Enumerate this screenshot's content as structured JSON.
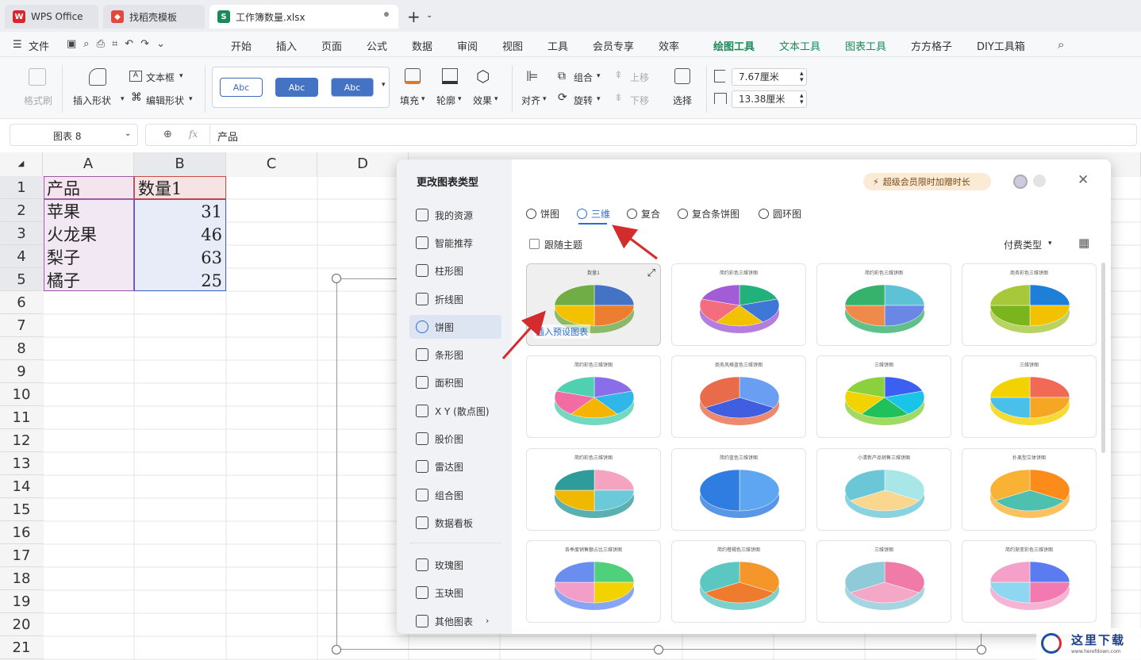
{
  "tabs": [
    {
      "label": "WPS Office",
      "icon": "wps-logo-icon"
    },
    {
      "label": "找稻壳模板",
      "icon": "docer-icon"
    },
    {
      "label": "工作簿数量.xlsx",
      "icon": "spreadsheet-icon"
    }
  ],
  "menu": {
    "file": "文件",
    "items": [
      "开始",
      "插入",
      "页面",
      "公式",
      "数据",
      "审阅",
      "视图",
      "工具",
      "会员专享",
      "效率",
      "绘图工具",
      "文本工具",
      "图表工具",
      "方方格子",
      "DIY工具箱"
    ]
  },
  "ribbon": {
    "format_painter": "格式刷",
    "insert_shape": "插入形状",
    "text_box": "文本框",
    "edit_shape": "编辑形状",
    "styles": [
      "Abc",
      "Abc",
      "Abc"
    ],
    "fill": "填充",
    "outline": "轮廓",
    "effect": "效果",
    "align": "对齐",
    "group": "组合",
    "rotate": "旋转",
    "move_up": "上移",
    "move_down": "下移",
    "select": "选择",
    "height": "7.67厘米",
    "width": "13.38厘米"
  },
  "formula_bar": {
    "name_box": "图表 8",
    "fx": "fx",
    "content": "产品"
  },
  "sheet": {
    "columns": [
      "A",
      "B",
      "C",
      "D"
    ],
    "rows": [
      "1",
      "2",
      "3",
      "4",
      "5",
      "6",
      "7",
      "8",
      "9",
      "10",
      "11",
      "12",
      "13",
      "14",
      "15",
      "16",
      "17",
      "18",
      "19",
      "20",
      "21"
    ],
    "header": [
      "产品",
      "数量1"
    ],
    "data": [
      [
        "苹果",
        "31"
      ],
      [
        "火龙果",
        "46"
      ],
      [
        "梨子",
        "63"
      ],
      [
        "橘子",
        "25"
      ]
    ]
  },
  "dialog": {
    "title": "更改图表类型",
    "promo": "超级会员限时加赠时长",
    "sidebar": [
      "我的资源",
      "智能推荐",
      "柱形图",
      "折线图",
      "饼图",
      "条形图",
      "面积图",
      "X Y (散点图)",
      "股价图",
      "雷达图",
      "组合图",
      "数据看板",
      "玫瑰图",
      "玉玦图",
      "其他图表"
    ],
    "selected_sidebar": "饼图",
    "pie_tabs": [
      "饼图",
      "三维",
      "复合",
      "复合条饼图",
      "圆环图"
    ],
    "selected_tab": "三维",
    "follow_theme": "跟随主题",
    "pay_type": "付费类型",
    "first_thumb_title": "数量1",
    "insert_preset": "插入预设图表",
    "thumb_titles": [
      "数量1",
      "简约彩色三维饼图",
      "简约彩色三维饼图",
      "商务彩色三维饼图",
      "简约彩色三维饼图",
      "商务风格蓝色三维饼图",
      "三维饼图",
      "三维饼图",
      "简约彩色三维饼图",
      "简约蓝色三维饼图",
      "小清新产品销售三维饼图",
      "扑离型立体饼图",
      "各季度销售额占比三维饼图",
      "简约橙褐色三维饼图",
      "三维饼图",
      "简约渐变彩色三维饼图"
    ]
  },
  "watermark": {
    "title": "这里下载",
    "url": "www.herefdown.com"
  },
  "colors": {
    "accent_green": "#1a8a5a",
    "accent_blue": "#2e6bd6",
    "red_arrow": "#d42c2c"
  }
}
